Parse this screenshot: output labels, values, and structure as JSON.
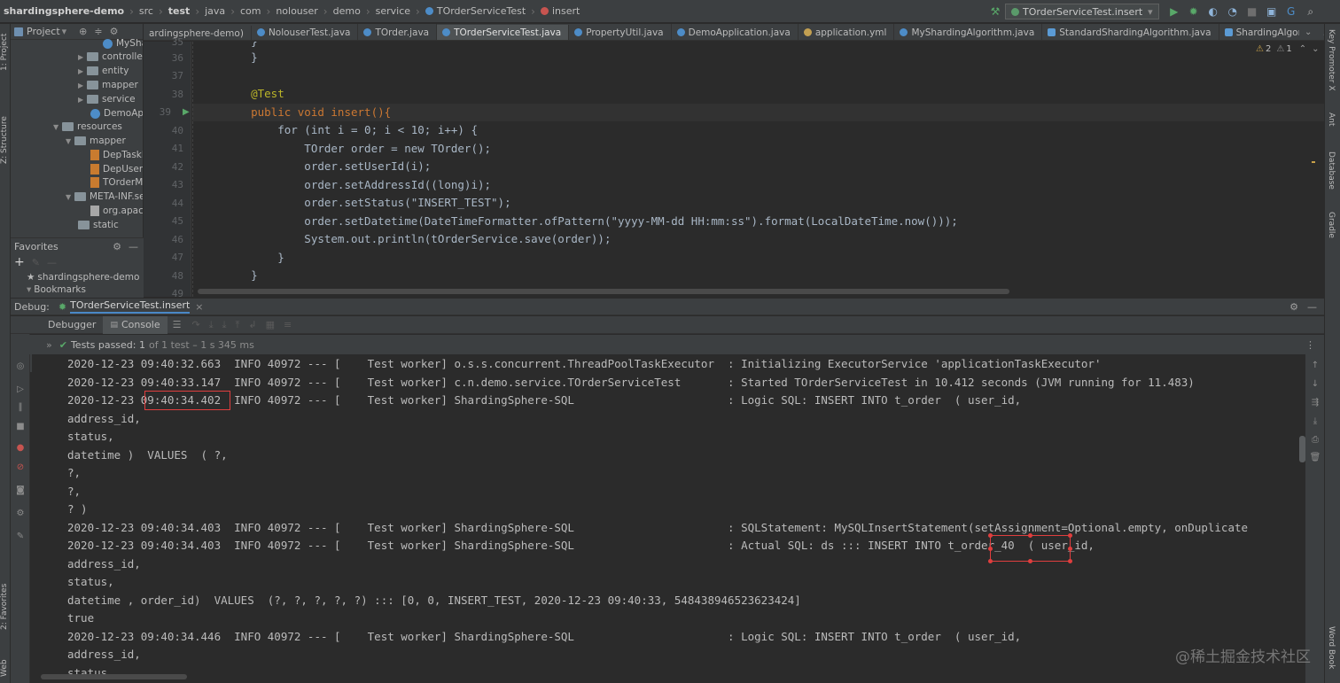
{
  "breadcrumbs": [
    "shardingsphere-demo",
    "src",
    "test",
    "java",
    "com",
    "nolouser",
    "demo",
    "service",
    "TOrderServiceTest",
    "insert"
  ],
  "run_config": "TOrderServiceTest.insert",
  "project_panel": {
    "title": "Project",
    "tree": [
      {
        "label": "MySha",
        "kind": "class"
      },
      {
        "label": "controller",
        "kind": "folder"
      },
      {
        "label": "entity",
        "kind": "folder"
      },
      {
        "label": "mapper",
        "kind": "folder"
      },
      {
        "label": "service",
        "kind": "folder"
      },
      {
        "label": "DemoApp",
        "kind": "class"
      },
      {
        "label": "resources",
        "kind": "folder"
      },
      {
        "label": "mapper",
        "kind": "folder"
      },
      {
        "label": "DepTaskI",
        "kind": "xml"
      },
      {
        "label": "DepUserIn",
        "kind": "xml"
      },
      {
        "label": "TOrderMa",
        "kind": "xml"
      },
      {
        "label": "META-INF.se",
        "kind": "folder"
      },
      {
        "label": "org.apach",
        "kind": "file"
      },
      {
        "label": "static",
        "kind": "folder"
      }
    ]
  },
  "favorites": {
    "title": "Favorites",
    "items": [
      "shardingsphere-demo",
      "Bookmarks"
    ]
  },
  "editor_tabs": [
    {
      "label": "ardingsphere-demo)",
      "active": false
    },
    {
      "label": "NolouserTest.java",
      "active": false
    },
    {
      "label": "TOrder.java",
      "active": false
    },
    {
      "label": "TOrderServiceTest.java",
      "active": true
    },
    {
      "label": "PropertyUtil.java",
      "active": false
    },
    {
      "label": "DemoApplication.java",
      "active": false
    },
    {
      "label": "application.yml",
      "active": false
    },
    {
      "label": "MyShardingAlgorithm.java",
      "active": false
    },
    {
      "label": "StandardShardingAlgorithm.java",
      "active": false
    },
    {
      "label": "ShardingAlgorithm.java",
      "active": false
    }
  ],
  "inspection": {
    "warnings": "2",
    "weak": "1"
  },
  "line_numbers": [
    "35",
    "36",
    "37",
    "38",
    "39",
    "40",
    "41",
    "42",
    "43",
    "44",
    "45",
    "46",
    "47",
    "48",
    "49"
  ],
  "code_lines": [
    "    }",
    "    }",
    "",
    "    @Test",
    "    public void insert(){",
    "        for (int i = 0; i < 10; i++) {",
    "            TOrder order = new TOrder();",
    "            order.setUserId(i);",
    "            order.setAddressId((long)i);",
    "            order.setStatus(\"INSERT_TEST\");",
    "            order.setDatetime(DateTimeFormatter.ofPattern(\"yyyy-MM-dd HH:mm:ss\").format(LocalDateTime.now()));",
    "            System.out.println(tOrderService.save(order));",
    "        }",
    "    }"
  ],
  "debug": {
    "label": "Debug:",
    "session": "TOrderServiceTest.insert",
    "tabs": [
      "Debugger",
      "Console"
    ],
    "active_tab": "Console",
    "tests_passed": "Tests passed: 1",
    "tests_detail": "of 1 test – 1 s 345 ms"
  },
  "console_lines": [
    "2020-12-23 09:40:32.663  INFO 40972 --- [    Test worker] o.s.s.concurrent.ThreadPoolTaskExecutor  : Initializing ExecutorService 'applicationTaskExecutor'",
    "2020-12-23 09:40:33.147  INFO 40972 --- [    Test worker] c.n.demo.service.TOrderServiceTest       : Started TOrderServiceTest in 10.412 seconds (JVM running for 11.483)",
    "2020-12-23 09:40:34.402  INFO 40972 --- [    Test worker] ShardingSphere-SQL                       : Logic SQL: INSERT INTO t_order  ( user_id,",
    "address_id,",
    "status,",
    "datetime )  VALUES  ( ?,",
    "?,",
    "?,",
    "? )",
    "2020-12-23 09:40:34.403  INFO 40972 --- [    Test worker] ShardingSphere-SQL                       : SQLStatement: MySQLInsertStatement(setAssignment=Optional.empty, onDuplicate",
    "2020-12-23 09:40:34.403  INFO 40972 --- [    Test worker] ShardingSphere-SQL                       : Actual SQL: ds ::: INSERT INTO t_order_40  ( user_id,",
    "address_id,",
    "status,",
    "datetime , order_id)  VALUES  (?, ?, ?, ?, ?) ::: [0, 0, INSERT_TEST, 2020-12-23 09:40:33, 548438946523623424]",
    "true",
    "2020-12-23 09:40:34.446  INFO 40972 --- [    Test worker] ShardingSphere-SQL                       : Logic SQL: INSERT INTO t_order  ( user_id,",
    "address_id,",
    "status,"
  ],
  "left_tool_tabs": [
    "1: Project",
    "Z: Structure",
    "2: Favorites",
    "Web"
  ],
  "right_tool_tabs": [
    "Key Promoter X",
    "Ant",
    "Database",
    "Gradle",
    "Word Book"
  ],
  "watermark": "@稀土掘金技术社区"
}
